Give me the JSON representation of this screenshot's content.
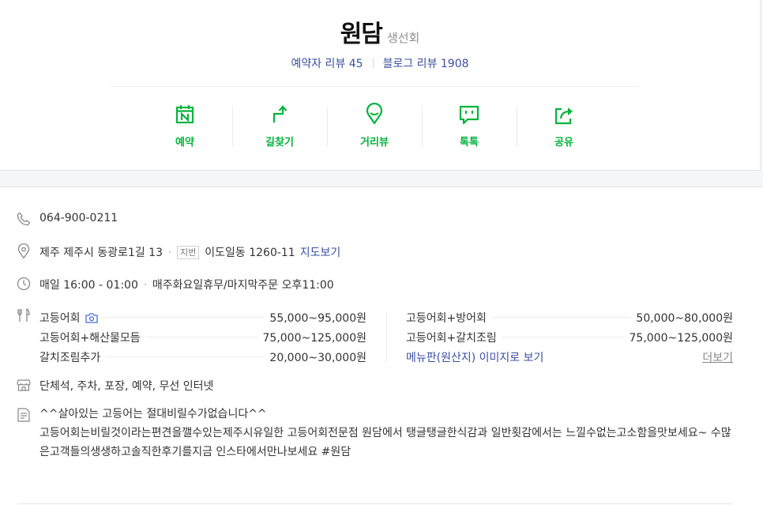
{
  "place": {
    "name": "원담",
    "category": "생선회"
  },
  "reviews": {
    "booking_review": "예약자 리뷰 45",
    "blog_review": "블로그 리뷰 1908"
  },
  "actions": [
    {
      "label": "예약",
      "icon": "calendar-n-icon"
    },
    {
      "label": "길찾기",
      "icon": "directions-icon"
    },
    {
      "label": "거리뷰",
      "icon": "street-view-pin-icon"
    },
    {
      "label": "톡톡",
      "icon": "talk-chat-icon"
    },
    {
      "label": "공유",
      "icon": "share-icon"
    }
  ],
  "info": {
    "phone": "064-900-0211",
    "address": {
      "road": "제주 제주시 동광로1길 13",
      "jibun_badge": "지번",
      "jibun": "이도일동 1260-11",
      "map_link": "지도보기"
    },
    "hours": {
      "main": "매일 16:00 - 01:00",
      "note": "매주화요일휴무/마지막주문 오후11:00"
    },
    "menu": {
      "left": [
        {
          "name": "고등어회",
          "price": "55,000~95,000원"
        },
        {
          "name": "고등어회+해산물모듬",
          "price": "75,000~125,000원"
        },
        {
          "name": "갈치조림추가",
          "price": "20,000~30,000원"
        }
      ],
      "right": [
        {
          "name": "고등어회+방어회",
          "price": "50,000~80,000원"
        },
        {
          "name": "고등어회+갈치조림",
          "price": "75,000~125,000원"
        }
      ],
      "menu_image_link": "메뉴판(원산지) 이미지로 보기",
      "more_link": "더보기"
    },
    "amenities": "단체석, 주차, 포장, 예약, 무선 인터넷",
    "description": {
      "headline": "^^살아있는 고등어는 절대비릴수가없습니다^^",
      "body": "고등어회는비릴것이라는편견을깰수있는제주시유일한 고등어회전문점 원담에서 탱글탱글한식감과 일반횟감에서는 느낄수없는고소함을맛보세요~ 수많은고객들의생생하고솔직한후기를지금 인스타에서만나보세요  #원담"
    }
  },
  "colors": {
    "accent_green": "#06b33e",
    "link_blue": "#3b4fa0"
  }
}
